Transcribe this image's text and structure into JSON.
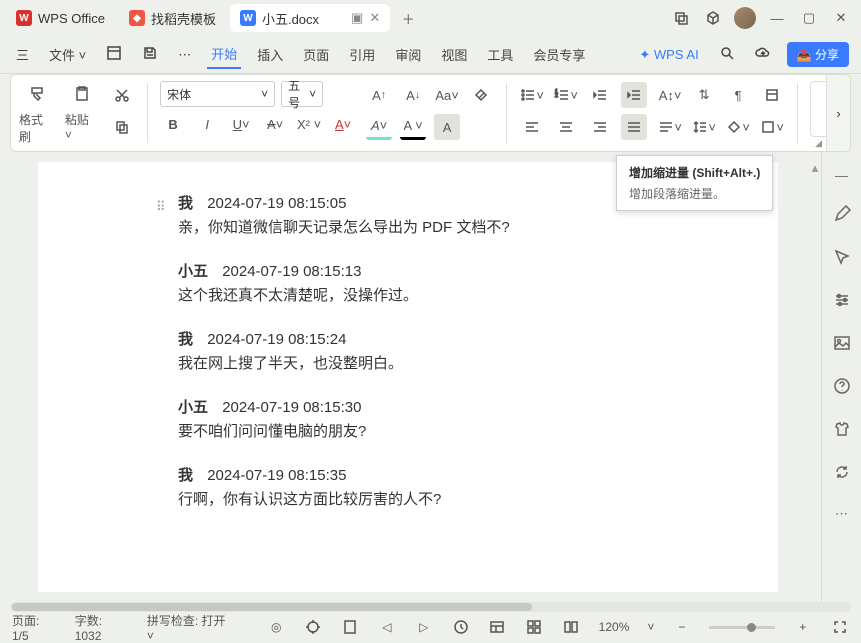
{
  "titlebar": {
    "tabs": [
      {
        "icon_bg": "#d9302e",
        "icon_fg": "#fff",
        "icon": "W",
        "label": "WPS Office"
      },
      {
        "icon_bg": "#e54",
        "icon_fg": "#fff",
        "icon": "◆",
        "label": "找稻壳模板"
      },
      {
        "icon_bg": "#3a7aff",
        "icon_fg": "#fff",
        "icon": "W",
        "label": "小五.docx",
        "active": true
      }
    ]
  },
  "menubar": {
    "hamburger": "三",
    "file": "文件",
    "items": [
      "开始",
      "插入",
      "页面",
      "引用",
      "审阅",
      "视图",
      "工具",
      "会员专享"
    ],
    "active_index": 0,
    "wps_ai": "WPS AI",
    "share": "分享"
  },
  "toolbar": {
    "format_painter": "格式刷",
    "paste": "粘贴",
    "font_name": "宋体",
    "font_size": "五号"
  },
  "tooltip": {
    "title": "增加缩进量 (Shift+Alt+.)",
    "desc": "增加段落缩进量。"
  },
  "document": {
    "messages": [
      {
        "name": "我",
        "ts": "2024-07-19 08:15:05",
        "txt": "亲，你知道微信聊天记录怎么导出为 PDF 文档不?"
      },
      {
        "name": "小五",
        "ts": "2024-07-19 08:15:13",
        "txt": "这个我还真不太清楚呢，没操作过。"
      },
      {
        "name": "我",
        "ts": "2024-07-19 08:15:24",
        "txt": "我在网上搜了半天，也没整明白。"
      },
      {
        "name": "小五",
        "ts": "2024-07-19 08:15:30",
        "txt": "要不咱们问问懂电脑的朋友?"
      },
      {
        "name": "我",
        "ts": "2024-07-19 08:15:35",
        "txt": "行啊，你有认识这方面比较厉害的人不?"
      }
    ]
  },
  "statusbar": {
    "page": "页面: 1/5",
    "words": "字数: 1032",
    "spell": "拼写检查: 打开",
    "zoom": "120%"
  }
}
